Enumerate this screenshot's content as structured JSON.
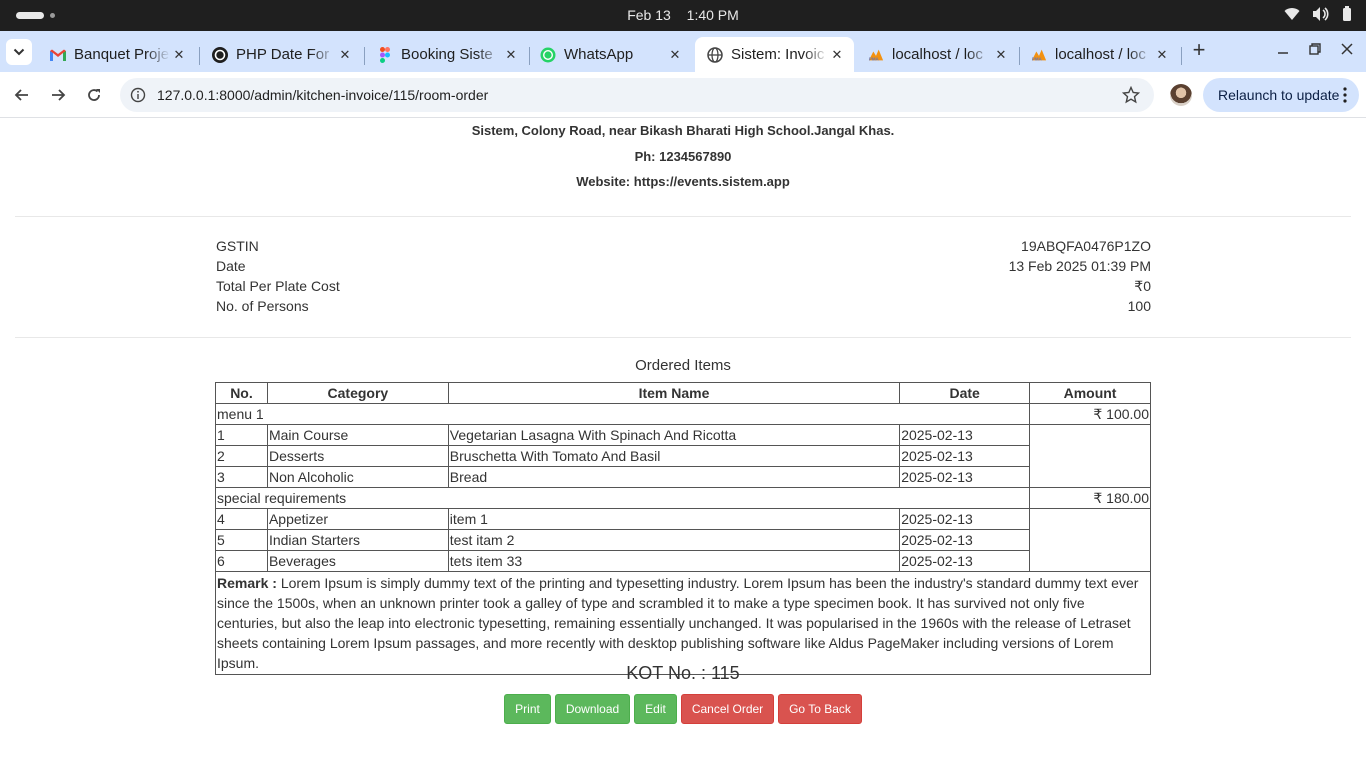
{
  "os": {
    "date": "Feb 13",
    "time": "1:40 PM"
  },
  "tabs": [
    {
      "title": "Banquet Proje",
      "icon": "gmail-icon"
    },
    {
      "title": "PHP Date For",
      "icon": "github-icon"
    },
    {
      "title": "Booking Siste",
      "icon": "figma-icon"
    },
    {
      "title": "WhatsApp",
      "icon": "whatsapp-icon"
    },
    {
      "title": "Sistem: Invoic",
      "icon": "globe-icon",
      "active": true
    },
    {
      "title": "localhost / loc",
      "icon": "phpmyadmin-icon"
    },
    {
      "title": "localhost / loc",
      "icon": "phpmyadmin-icon"
    }
  ],
  "toolbar": {
    "url": "127.0.0.1:8000/admin/kitchen-invoice/115/room-order",
    "relaunch_label": "Relaunch to update"
  },
  "invoice": {
    "address": "Sistem, Colony Road, near Bikash Bharati High School.Jangal Khas.",
    "phone": "Ph: 1234567890",
    "website": "Website: https://events.sistem.app",
    "details": [
      {
        "label": "GSTIN",
        "value": "19ABQFA0476P1ZO"
      },
      {
        "label": "Date",
        "value": "13 Feb 2025 01:39 PM"
      },
      {
        "label": "Total Per Plate Cost",
        "value": "₹0"
      },
      {
        "label": "No. of Persons",
        "value": "100"
      }
    ],
    "ordered_heading": "Ordered Items",
    "columns": [
      "No.",
      "Category",
      "Item Name",
      "Date",
      "Amount"
    ],
    "groups": [
      {
        "name": "menu 1",
        "amount": "₹ 100.00",
        "rows": [
          {
            "no": "1",
            "category": "Main Course",
            "item": "Vegetarian Lasagna With Spinach And Ricotta",
            "date": "2025-02-13"
          },
          {
            "no": "2",
            "category": "Desserts",
            "item": "Bruschetta With Tomato And Basil",
            "date": "2025-02-13"
          },
          {
            "no": "3",
            "category": "Non Alcoholic",
            "item": "Bread",
            "date": "2025-02-13"
          }
        ]
      },
      {
        "name": "special requirements",
        "amount": "₹ 180.00",
        "rows": [
          {
            "no": "4",
            "category": "Appetizer",
            "item": "item 1",
            "date": "2025-02-13"
          },
          {
            "no": "5",
            "category": "Indian Starters",
            "item": "test itam 2",
            "date": "2025-02-13"
          },
          {
            "no": "6",
            "category": "Beverages",
            "item": "tets item 33",
            "date": "2025-02-13"
          }
        ]
      }
    ],
    "remark_label": "Remark :",
    "remark_text": "Lorem Ipsum is simply dummy text of the printing and typesetting industry. Lorem Ipsum has been the industry's standard dummy text ever since the 1500s, when an unknown printer took a galley of type and scrambled it to make a type specimen book. It has survived not only five centuries, but also the leap into electronic typesetting, remaining essentially unchanged. It was popularised in the 1960s with the release of Letraset sheets containing Lorem Ipsum passages, and more recently with desktop publishing software like Aldus PageMaker including versions of Lorem Ipsum.",
    "kot": "KOT No. : 115"
  },
  "actions": {
    "print": "Print",
    "download": "Download",
    "edit": "Edit",
    "cancel": "Cancel Order",
    "back": "Go To Back"
  },
  "colors": {
    "green": "#5cb85c",
    "red": "#d9534f",
    "tabstrip": "#d3e3fd"
  }
}
